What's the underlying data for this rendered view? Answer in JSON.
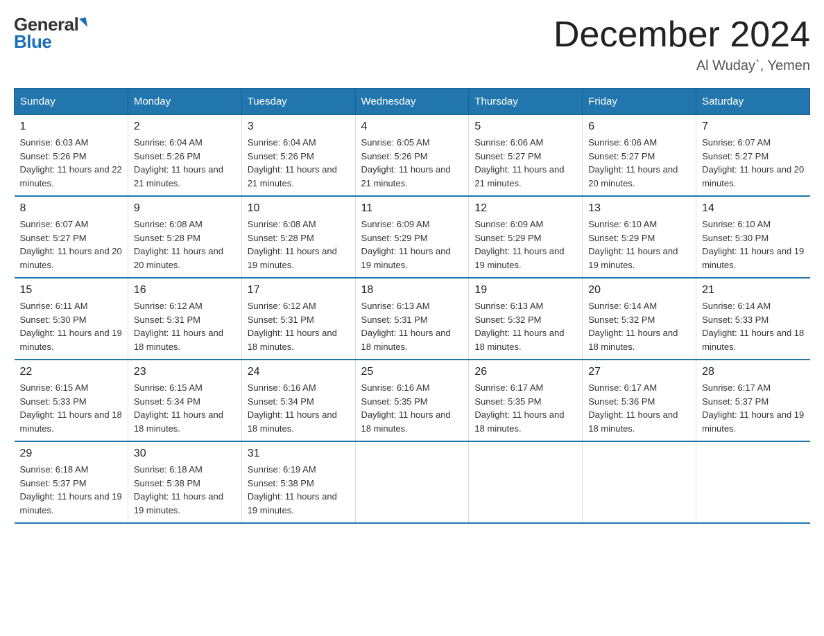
{
  "logo": {
    "general": "General",
    "blue": "Blue"
  },
  "title": "December 2024",
  "location": "Al Wuday`, Yemen",
  "days_of_week": [
    "Sunday",
    "Monday",
    "Tuesday",
    "Wednesday",
    "Thursday",
    "Friday",
    "Saturday"
  ],
  "weeks": [
    [
      {
        "day": "1",
        "sunrise": "6:03 AM",
        "sunset": "5:26 PM",
        "daylight": "11 hours and 22 minutes."
      },
      {
        "day": "2",
        "sunrise": "6:04 AM",
        "sunset": "5:26 PM",
        "daylight": "11 hours and 21 minutes."
      },
      {
        "day": "3",
        "sunrise": "6:04 AM",
        "sunset": "5:26 PM",
        "daylight": "11 hours and 21 minutes."
      },
      {
        "day": "4",
        "sunrise": "6:05 AM",
        "sunset": "5:26 PM",
        "daylight": "11 hours and 21 minutes."
      },
      {
        "day": "5",
        "sunrise": "6:06 AM",
        "sunset": "5:27 PM",
        "daylight": "11 hours and 21 minutes."
      },
      {
        "day": "6",
        "sunrise": "6:06 AM",
        "sunset": "5:27 PM",
        "daylight": "11 hours and 20 minutes."
      },
      {
        "day": "7",
        "sunrise": "6:07 AM",
        "sunset": "5:27 PM",
        "daylight": "11 hours and 20 minutes."
      }
    ],
    [
      {
        "day": "8",
        "sunrise": "6:07 AM",
        "sunset": "5:27 PM",
        "daylight": "11 hours and 20 minutes."
      },
      {
        "day": "9",
        "sunrise": "6:08 AM",
        "sunset": "5:28 PM",
        "daylight": "11 hours and 20 minutes."
      },
      {
        "day": "10",
        "sunrise": "6:08 AM",
        "sunset": "5:28 PM",
        "daylight": "11 hours and 19 minutes."
      },
      {
        "day": "11",
        "sunrise": "6:09 AM",
        "sunset": "5:29 PM",
        "daylight": "11 hours and 19 minutes."
      },
      {
        "day": "12",
        "sunrise": "6:09 AM",
        "sunset": "5:29 PM",
        "daylight": "11 hours and 19 minutes."
      },
      {
        "day": "13",
        "sunrise": "6:10 AM",
        "sunset": "5:29 PM",
        "daylight": "11 hours and 19 minutes."
      },
      {
        "day": "14",
        "sunrise": "6:10 AM",
        "sunset": "5:30 PM",
        "daylight": "11 hours and 19 minutes."
      }
    ],
    [
      {
        "day": "15",
        "sunrise": "6:11 AM",
        "sunset": "5:30 PM",
        "daylight": "11 hours and 19 minutes."
      },
      {
        "day": "16",
        "sunrise": "6:12 AM",
        "sunset": "5:31 PM",
        "daylight": "11 hours and 18 minutes."
      },
      {
        "day": "17",
        "sunrise": "6:12 AM",
        "sunset": "5:31 PM",
        "daylight": "11 hours and 18 minutes."
      },
      {
        "day": "18",
        "sunrise": "6:13 AM",
        "sunset": "5:31 PM",
        "daylight": "11 hours and 18 minutes."
      },
      {
        "day": "19",
        "sunrise": "6:13 AM",
        "sunset": "5:32 PM",
        "daylight": "11 hours and 18 minutes."
      },
      {
        "day": "20",
        "sunrise": "6:14 AM",
        "sunset": "5:32 PM",
        "daylight": "11 hours and 18 minutes."
      },
      {
        "day": "21",
        "sunrise": "6:14 AM",
        "sunset": "5:33 PM",
        "daylight": "11 hours and 18 minutes."
      }
    ],
    [
      {
        "day": "22",
        "sunrise": "6:15 AM",
        "sunset": "5:33 PM",
        "daylight": "11 hours and 18 minutes."
      },
      {
        "day": "23",
        "sunrise": "6:15 AM",
        "sunset": "5:34 PM",
        "daylight": "11 hours and 18 minutes."
      },
      {
        "day": "24",
        "sunrise": "6:16 AM",
        "sunset": "5:34 PM",
        "daylight": "11 hours and 18 minutes."
      },
      {
        "day": "25",
        "sunrise": "6:16 AM",
        "sunset": "5:35 PM",
        "daylight": "11 hours and 18 minutes."
      },
      {
        "day": "26",
        "sunrise": "6:17 AM",
        "sunset": "5:35 PM",
        "daylight": "11 hours and 18 minutes."
      },
      {
        "day": "27",
        "sunrise": "6:17 AM",
        "sunset": "5:36 PM",
        "daylight": "11 hours and 18 minutes."
      },
      {
        "day": "28",
        "sunrise": "6:17 AM",
        "sunset": "5:37 PM",
        "daylight": "11 hours and 19 minutes."
      }
    ],
    [
      {
        "day": "29",
        "sunrise": "6:18 AM",
        "sunset": "5:37 PM",
        "daylight": "11 hours and 19 minutes."
      },
      {
        "day": "30",
        "sunrise": "6:18 AM",
        "sunset": "5:38 PM",
        "daylight": "11 hours and 19 minutes."
      },
      {
        "day": "31",
        "sunrise": "6:19 AM",
        "sunset": "5:38 PM",
        "daylight": "11 hours and 19 minutes."
      },
      null,
      null,
      null,
      null
    ]
  ]
}
